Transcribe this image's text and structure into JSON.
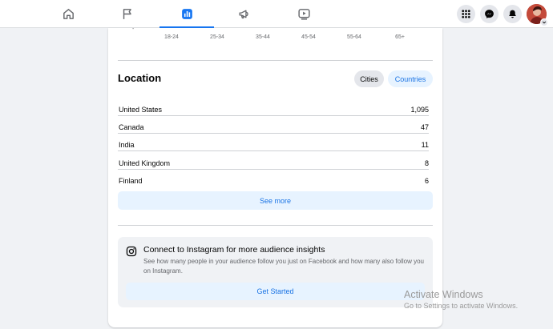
{
  "nav": {
    "tabs": [
      {
        "icon": "home-icon"
      },
      {
        "icon": "flag-icon"
      },
      {
        "icon": "insights-icon",
        "active": true
      },
      {
        "icon": "megaphone-icon"
      },
      {
        "icon": "video-icon"
      }
    ],
    "accent": "#1877f2",
    "actions": [
      "menu-grid-icon",
      "messenger-icon",
      "notifications-icon"
    ]
  },
  "age_chart": {
    "stub": "-",
    "labels": [
      "18-24",
      "25-34",
      "35-44",
      "45-54",
      "55-64",
      "65+"
    ]
  },
  "location": {
    "title": "Location",
    "filters": {
      "cities": "Cities",
      "countries": "Countries",
      "selected": "Cities"
    },
    "rows": [
      {
        "name": "United States",
        "value": "1,095"
      },
      {
        "name": "Canada",
        "value": "47"
      },
      {
        "name": "India",
        "value": "11"
      },
      {
        "name": "United Kingdom",
        "value": "8"
      },
      {
        "name": "Finland",
        "value": "6"
      }
    ],
    "see_more": "See more"
  },
  "instagram": {
    "title": "Connect to Instagram for more audience insights",
    "description": "See how many people in your audience follow you just on Facebook and how many also follow you on Instagram.",
    "button": "Get Started"
  },
  "watermark": {
    "title": "Activate Windows",
    "subtitle": "Go to Settings to activate Windows."
  }
}
